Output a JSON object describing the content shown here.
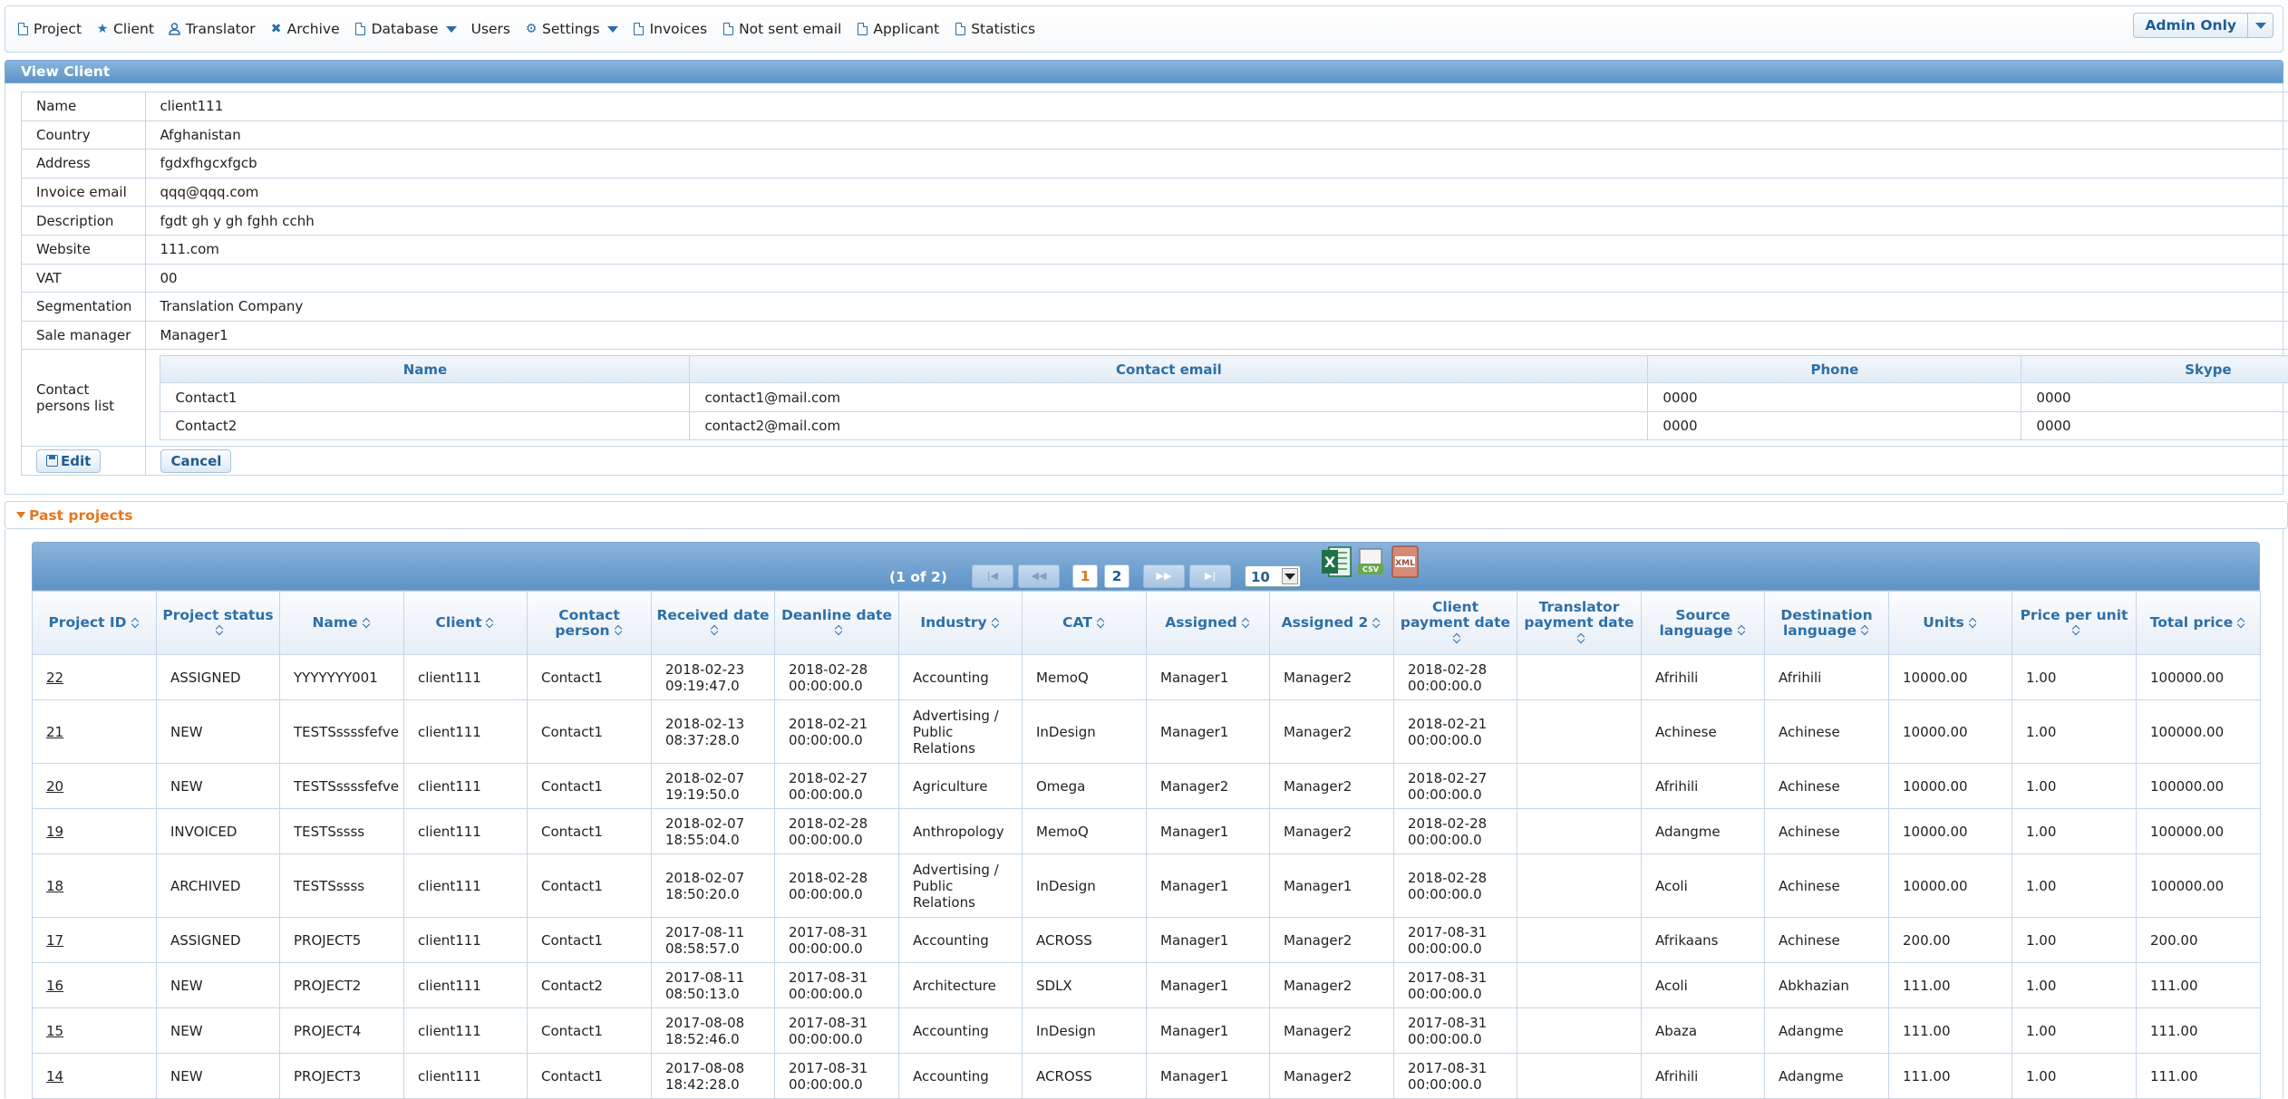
{
  "menu": {
    "items": [
      {
        "label": "Project",
        "icon": "document-icon"
      },
      {
        "label": "Client",
        "icon": "star-icon"
      },
      {
        "label": "Translator",
        "icon": "person-icon"
      },
      {
        "label": "Archive",
        "icon": "close-icon"
      },
      {
        "label": "Database",
        "icon": "document-icon",
        "dropdown": true
      },
      {
        "label": "Users",
        "icon": ""
      },
      {
        "label": "Settings",
        "icon": "gear-icon",
        "dropdown": true
      },
      {
        "label": "Invoices",
        "icon": "document-icon"
      },
      {
        "label": "Not sent email",
        "icon": "document-icon"
      },
      {
        "label": "Applicant",
        "icon": "document-icon"
      },
      {
        "label": "Statistics",
        "icon": "document-icon"
      }
    ],
    "admin_label": "Admin Only"
  },
  "view_client": {
    "title": "View Client",
    "fields": [
      {
        "label": "Name",
        "value": "client111"
      },
      {
        "label": "Country",
        "value": "Afghanistan"
      },
      {
        "label": "Address",
        "value": "fgdxfhgcxfgcb"
      },
      {
        "label": "Invoice email",
        "value": "qqq@qqq.com"
      },
      {
        "label": "Description",
        "value": "fgdt gh y gh fghh cchh"
      },
      {
        "label": "Website",
        "value": "111.com"
      },
      {
        "label": "VAT",
        "value": "00"
      },
      {
        "label": "Segmentation",
        "value": "Translation Company"
      },
      {
        "label": "Sale manager",
        "value": "Manager1"
      }
    ],
    "contacts_label": "Contact persons list",
    "contacts_columns": [
      "Name",
      "Contact email",
      "Phone",
      "Skype"
    ],
    "contacts": [
      [
        "Contact1",
        "contact1@mail.com",
        "0000",
        "0000"
      ],
      [
        "Contact2",
        "contact2@mail.com",
        "0000",
        "0000"
      ]
    ],
    "edit_label": "Edit",
    "cancel_label": "Cancel"
  },
  "past_projects": {
    "title": "Past projects",
    "pager": {
      "count_text": "(1 of 2)",
      "pages": [
        "1",
        "2"
      ],
      "rows_per_page": "10",
      "first": "|◀",
      "prev": "◀◀",
      "next": "▶▶",
      "last": "▶|",
      "xml_label": "XML"
    },
    "columns": [
      "Project ID",
      "Project status",
      "Name",
      "Client",
      "Contact person",
      "Received date",
      "Deanline date",
      "Industry",
      "CAT",
      "Assigned",
      "Assigned 2",
      "Client payment date",
      "Translator payment date",
      "Source language",
      "Destination language",
      "Units",
      "Price per unit",
      "Total price"
    ],
    "rows": [
      [
        "22",
        "ASSIGNED",
        "YYYYYYY001",
        "client111",
        "Contact1",
        "2018-02-23 09:19:47.0",
        "2018-02-28 00:00:00.0",
        "Accounting",
        "MemoQ",
        "Manager1",
        "Manager2",
        "2018-02-28 00:00:00.0",
        "",
        "Afrihili",
        "Afrihili",
        "10000.00",
        "1.00",
        "100000.00"
      ],
      [
        "21",
        "NEW",
        "TESTSssssfefve",
        "client111",
        "Contact1",
        "2018-02-13 08:37:28.0",
        "2018-02-21 00:00:00.0",
        "Advertising / Public Relations",
        "InDesign",
        "Manager1",
        "Manager2",
        "2018-02-21 00:00:00.0",
        "",
        "Achinese",
        "Achinese",
        "10000.00",
        "1.00",
        "100000.00"
      ],
      [
        "20",
        "NEW",
        "TESTSssssfefve",
        "client111",
        "Contact1",
        "2018-02-07 19:19:50.0",
        "2018-02-27 00:00:00.0",
        "Agriculture",
        "Omega",
        "Manager2",
        "Manager2",
        "2018-02-27 00:00:00.0",
        "",
        "Afrihili",
        "Achinese",
        "10000.00",
        "1.00",
        "100000.00"
      ],
      [
        "19",
        "INVOICED",
        "TESTSssss",
        "client111",
        "Contact1",
        "2018-02-07 18:55:04.0",
        "2018-02-28 00:00:00.0",
        "Anthropology",
        "MemoQ",
        "Manager1",
        "Manager2",
        "2018-02-28 00:00:00.0",
        "",
        "Adangme",
        "Achinese",
        "10000.00",
        "1.00",
        "100000.00"
      ],
      [
        "18",
        "ARCHIVED",
        "TESTSssss",
        "client111",
        "Contact1",
        "2018-02-07 18:50:20.0",
        "2018-02-28 00:00:00.0",
        "Advertising / Public Relations",
        "InDesign",
        "Manager1",
        "Manager1",
        "2018-02-28 00:00:00.0",
        "",
        "Acoli",
        "Achinese",
        "10000.00",
        "1.00",
        "100000.00"
      ],
      [
        "17",
        "ASSIGNED",
        "PROJECT5",
        "client111",
        "Contact1",
        "2017-08-11 08:58:57.0",
        "2017-08-31 00:00:00.0",
        "Accounting",
        "ACROSS",
        "Manager1",
        "Manager2",
        "2017-08-31 00:00:00.0",
        "",
        "Afrikaans",
        "Achinese",
        "200.00",
        "1.00",
        "200.00"
      ],
      [
        "16",
        "NEW",
        "PROJECT2",
        "client111",
        "Contact2",
        "2017-08-11 08:50:13.0",
        "2017-08-31 00:00:00.0",
        "Architecture",
        "SDLX",
        "Manager1",
        "Manager2",
        "2017-08-31 00:00:00.0",
        "",
        "Acoli",
        "Abkhazian",
        "111.00",
        "1.00",
        "111.00"
      ],
      [
        "15",
        "NEW",
        "PROJECT4",
        "client111",
        "Contact1",
        "2017-08-08 18:52:46.0",
        "2017-08-31 00:00:00.0",
        "Accounting",
        "InDesign",
        "Manager1",
        "Manager2",
        "2017-08-31 00:00:00.0",
        "",
        "Abaza",
        "Adangme",
        "111.00",
        "1.00",
        "111.00"
      ],
      [
        "14",
        "NEW",
        "PROJECT3",
        "client111",
        "Contact1",
        "2017-08-08 18:42:28.0",
        "2017-08-31 00:00:00.0",
        "Accounting",
        "ACROSS",
        "Manager1",
        "Manager2",
        "2017-08-31 00:00:00.0",
        "",
        "Afrihili",
        "Adangme",
        "111.00",
        "1.00",
        "111.00"
      ]
    ]
  }
}
